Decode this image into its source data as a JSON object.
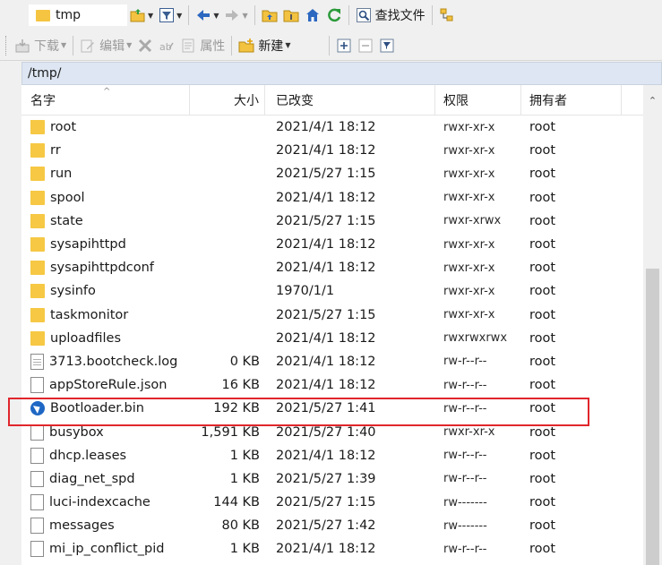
{
  "toolbar1": {
    "path_combo_value": "tmp",
    "search_label": "查找文件"
  },
  "toolbar2": {
    "download_label": "下载",
    "edit_label": "编辑",
    "properties_label": "属性",
    "new_label": "新建"
  },
  "path_bar": {
    "path": "/tmp/"
  },
  "columns": {
    "name": "名字",
    "size": "大小",
    "modified": "已改变",
    "permissions": "权限",
    "owner": "拥有者"
  },
  "files": [
    {
      "name": "root",
      "size": "",
      "modified": "2021/4/1 18:12",
      "permissions": "rwxr-xr-x",
      "owner": "root",
      "icon": "folder-icon"
    },
    {
      "name": "rr",
      "size": "",
      "modified": "2021/4/1 18:12",
      "permissions": "rwxr-xr-x",
      "owner": "root",
      "icon": "folder-icon"
    },
    {
      "name": "run",
      "size": "",
      "modified": "2021/5/27 1:15",
      "permissions": "rwxr-xr-x",
      "owner": "root",
      "icon": "folder-icon"
    },
    {
      "name": "spool",
      "size": "",
      "modified": "2021/4/1 18:12",
      "permissions": "rwxr-xr-x",
      "owner": "root",
      "icon": "folder-icon"
    },
    {
      "name": "state",
      "size": "",
      "modified": "2021/5/27 1:15",
      "permissions": "rwxr-xrwx",
      "owner": "root",
      "icon": "folder-icon"
    },
    {
      "name": "sysapihttpd",
      "size": "",
      "modified": "2021/4/1 18:12",
      "permissions": "rwxr-xr-x",
      "owner": "root",
      "icon": "folder-icon"
    },
    {
      "name": "sysapihttpdconf",
      "size": "",
      "modified": "2021/4/1 18:12",
      "permissions": "rwxr-xr-x",
      "owner": "root",
      "icon": "folder-icon"
    },
    {
      "name": "sysinfo",
      "size": "",
      "modified": "1970/1/1",
      "permissions": "rwxr-xr-x",
      "owner": "root",
      "icon": "folder-icon"
    },
    {
      "name": "taskmonitor",
      "size": "",
      "modified": "2021/5/27 1:15",
      "permissions": "rwxr-xr-x",
      "owner": "root",
      "icon": "folder-icon"
    },
    {
      "name": "uploadfiles",
      "size": "",
      "modified": "2021/4/1 18:12",
      "permissions": "rwxrwxrwx",
      "owner": "root",
      "icon": "folder-icon"
    },
    {
      "name": "3713.bootcheck.log",
      "size": "0 KB",
      "modified": "2021/4/1 18:12",
      "permissions": "rw-r--r--",
      "owner": "root",
      "icon": "log-file-icon"
    },
    {
      "name": "appStoreRule.json",
      "size": "16 KB",
      "modified": "2021/4/1 18:12",
      "permissions": "rw-r--r--",
      "owner": "root",
      "icon": "file-icon"
    },
    {
      "name": "Bootloader.bin",
      "size": "192 KB",
      "modified": "2021/5/27 1:41",
      "permissions": "rw-r--r--",
      "owner": "root",
      "icon": "bin-file-icon"
    },
    {
      "name": "busybox",
      "size": "1,591 KB",
      "modified": "2021/5/27 1:40",
      "permissions": "rwxr-xr-x",
      "owner": "root",
      "icon": "file-icon"
    },
    {
      "name": "dhcp.leases",
      "size": "1 KB",
      "modified": "2021/4/1 18:12",
      "permissions": "rw-r--r--",
      "owner": "root",
      "icon": "file-icon"
    },
    {
      "name": "diag_net_spd",
      "size": "1 KB",
      "modified": "2021/5/27 1:39",
      "permissions": "rw-r--r--",
      "owner": "root",
      "icon": "file-icon"
    },
    {
      "name": "luci-indexcache",
      "size": "144 KB",
      "modified": "2021/5/27 1:15",
      "permissions": "rw-------",
      "owner": "root",
      "icon": "file-icon"
    },
    {
      "name": "messages",
      "size": "80 KB",
      "modified": "2021/5/27 1:42",
      "permissions": "rw-------",
      "owner": "root",
      "icon": "file-icon"
    },
    {
      "name": "mi_ip_conflict_pid",
      "size": "1 KB",
      "modified": "2021/4/1 18:12",
      "permissions": "rw-r--r--",
      "owner": "root",
      "icon": "file-icon"
    }
  ],
  "colors": {
    "highlight_border": "#e0262c",
    "path_bar_bg": "#dde6f2",
    "folder": "#f6c844"
  }
}
